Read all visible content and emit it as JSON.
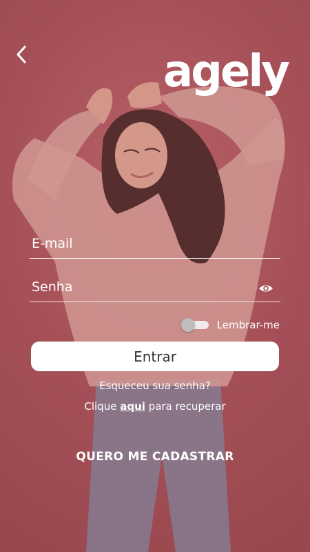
{
  "app": {
    "logo_text": "agely"
  },
  "form": {
    "email_placeholder": "E-mail",
    "password_placeholder": "Senha",
    "remember_label": "Lembrar-me",
    "remember_checked": false,
    "enter_label": "Entrar",
    "forgot_line1": "Esqueceu sua senha?",
    "forgot_line2_prefix": "Clique ",
    "forgot_link": "aqui",
    "forgot_line2_suffix": " para recuperar",
    "register_label": "QUERO ME CADASTRAR"
  },
  "icons": {
    "back": "chevron-left-icon",
    "eye": "eye-icon"
  },
  "colors": {
    "background": "#a9545c",
    "button_bg": "#ffffff",
    "button_text": "#333333",
    "text": "#ffffff"
  }
}
